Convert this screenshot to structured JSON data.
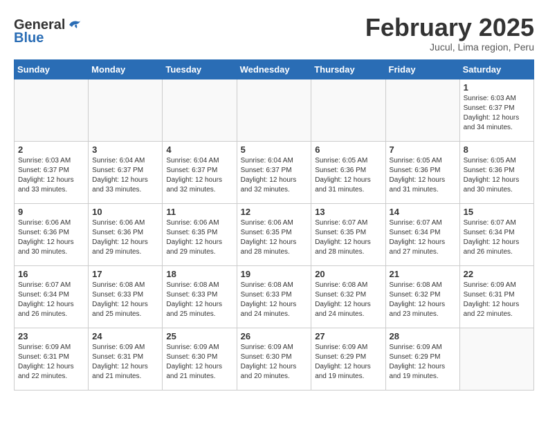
{
  "logo": {
    "general": "General",
    "blue": "Blue"
  },
  "header": {
    "month": "February 2025",
    "location": "Jucul, Lima region, Peru"
  },
  "weekdays": [
    "Sunday",
    "Monday",
    "Tuesday",
    "Wednesday",
    "Thursday",
    "Friday",
    "Saturday"
  ],
  "weeks": [
    [
      {
        "day": "",
        "info": ""
      },
      {
        "day": "",
        "info": ""
      },
      {
        "day": "",
        "info": ""
      },
      {
        "day": "",
        "info": ""
      },
      {
        "day": "",
        "info": ""
      },
      {
        "day": "",
        "info": ""
      },
      {
        "day": "1",
        "info": "Sunrise: 6:03 AM\nSunset: 6:37 PM\nDaylight: 12 hours and 34 minutes."
      }
    ],
    [
      {
        "day": "2",
        "info": "Sunrise: 6:03 AM\nSunset: 6:37 PM\nDaylight: 12 hours and 33 minutes."
      },
      {
        "day": "3",
        "info": "Sunrise: 6:04 AM\nSunset: 6:37 PM\nDaylight: 12 hours and 33 minutes."
      },
      {
        "day": "4",
        "info": "Sunrise: 6:04 AM\nSunset: 6:37 PM\nDaylight: 12 hours and 32 minutes."
      },
      {
        "day": "5",
        "info": "Sunrise: 6:04 AM\nSunset: 6:37 PM\nDaylight: 12 hours and 32 minutes."
      },
      {
        "day": "6",
        "info": "Sunrise: 6:05 AM\nSunset: 6:36 PM\nDaylight: 12 hours and 31 minutes."
      },
      {
        "day": "7",
        "info": "Sunrise: 6:05 AM\nSunset: 6:36 PM\nDaylight: 12 hours and 31 minutes."
      },
      {
        "day": "8",
        "info": "Sunrise: 6:05 AM\nSunset: 6:36 PM\nDaylight: 12 hours and 30 minutes."
      }
    ],
    [
      {
        "day": "9",
        "info": "Sunrise: 6:06 AM\nSunset: 6:36 PM\nDaylight: 12 hours and 30 minutes."
      },
      {
        "day": "10",
        "info": "Sunrise: 6:06 AM\nSunset: 6:36 PM\nDaylight: 12 hours and 29 minutes."
      },
      {
        "day": "11",
        "info": "Sunrise: 6:06 AM\nSunset: 6:35 PM\nDaylight: 12 hours and 29 minutes."
      },
      {
        "day": "12",
        "info": "Sunrise: 6:06 AM\nSunset: 6:35 PM\nDaylight: 12 hours and 28 minutes."
      },
      {
        "day": "13",
        "info": "Sunrise: 6:07 AM\nSunset: 6:35 PM\nDaylight: 12 hours and 28 minutes."
      },
      {
        "day": "14",
        "info": "Sunrise: 6:07 AM\nSunset: 6:34 PM\nDaylight: 12 hours and 27 minutes."
      },
      {
        "day": "15",
        "info": "Sunrise: 6:07 AM\nSunset: 6:34 PM\nDaylight: 12 hours and 26 minutes."
      }
    ],
    [
      {
        "day": "16",
        "info": "Sunrise: 6:07 AM\nSunset: 6:34 PM\nDaylight: 12 hours and 26 minutes."
      },
      {
        "day": "17",
        "info": "Sunrise: 6:08 AM\nSunset: 6:33 PM\nDaylight: 12 hours and 25 minutes."
      },
      {
        "day": "18",
        "info": "Sunrise: 6:08 AM\nSunset: 6:33 PM\nDaylight: 12 hours and 25 minutes."
      },
      {
        "day": "19",
        "info": "Sunrise: 6:08 AM\nSunset: 6:33 PM\nDaylight: 12 hours and 24 minutes."
      },
      {
        "day": "20",
        "info": "Sunrise: 6:08 AM\nSunset: 6:32 PM\nDaylight: 12 hours and 24 minutes."
      },
      {
        "day": "21",
        "info": "Sunrise: 6:08 AM\nSunset: 6:32 PM\nDaylight: 12 hours and 23 minutes."
      },
      {
        "day": "22",
        "info": "Sunrise: 6:09 AM\nSunset: 6:31 PM\nDaylight: 12 hours and 22 minutes."
      }
    ],
    [
      {
        "day": "23",
        "info": "Sunrise: 6:09 AM\nSunset: 6:31 PM\nDaylight: 12 hours and 22 minutes."
      },
      {
        "day": "24",
        "info": "Sunrise: 6:09 AM\nSunset: 6:31 PM\nDaylight: 12 hours and 21 minutes."
      },
      {
        "day": "25",
        "info": "Sunrise: 6:09 AM\nSunset: 6:30 PM\nDaylight: 12 hours and 21 minutes."
      },
      {
        "day": "26",
        "info": "Sunrise: 6:09 AM\nSunset: 6:30 PM\nDaylight: 12 hours and 20 minutes."
      },
      {
        "day": "27",
        "info": "Sunrise: 6:09 AM\nSunset: 6:29 PM\nDaylight: 12 hours and 19 minutes."
      },
      {
        "day": "28",
        "info": "Sunrise: 6:09 AM\nSunset: 6:29 PM\nDaylight: 12 hours and 19 minutes."
      },
      {
        "day": "",
        "info": ""
      }
    ]
  ]
}
